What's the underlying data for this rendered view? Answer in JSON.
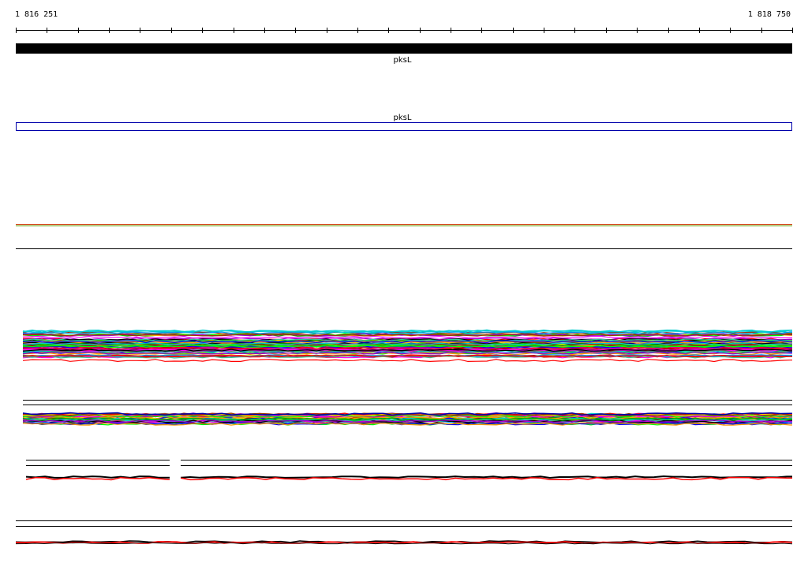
{
  "ruler": {
    "start_label": "1 816 251",
    "end_label": "1 818 750"
  },
  "tracks": {
    "gene_bar": {
      "label": "pksL"
    },
    "gene_outline": {
      "label": "pksL",
      "outline_color": "#0000aa"
    }
  },
  "colors": {
    "gene_fill": "#000000",
    "pair_lines": [
      "#cc3300",
      "#669900"
    ],
    "palette": [
      "#00cccc",
      "#0000ff",
      "#ff00ff",
      "#ff0000",
      "#00ff00",
      "#000000",
      "#ffcc00",
      "#993300",
      "#00aa00",
      "#9900cc",
      "#ff9900",
      "#0099ff",
      "#cc0099",
      "#666666",
      "#33cc99",
      "#aa0000"
    ]
  }
}
